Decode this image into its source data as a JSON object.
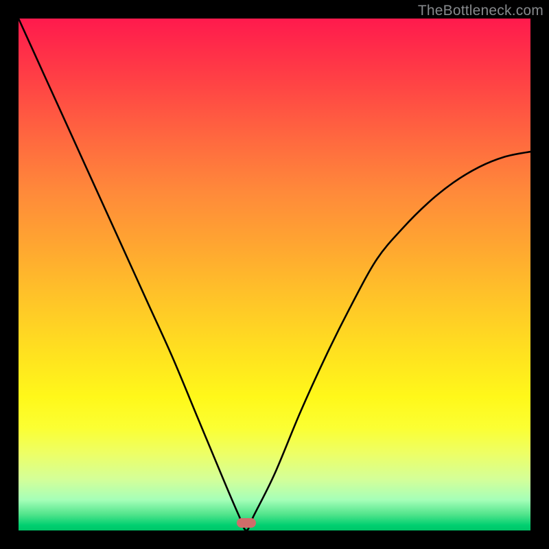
{
  "watermark": "TheBottleneck.com",
  "marker": {
    "x_frac": 0.445,
    "y_frac": 0.985
  },
  "chart_data": {
    "type": "line",
    "title": "",
    "xlabel": "",
    "ylabel": "",
    "xlim": [
      0,
      1
    ],
    "ylim": [
      0,
      1
    ],
    "series": [
      {
        "name": "bottleneck-curve",
        "x": [
          0.0,
          0.05,
          0.1,
          0.15,
          0.2,
          0.25,
          0.3,
          0.35,
          0.4,
          0.43,
          0.445,
          0.46,
          0.5,
          0.55,
          0.6,
          0.65,
          0.7,
          0.75,
          0.8,
          0.85,
          0.9,
          0.95,
          1.0
        ],
        "y": [
          1.0,
          0.89,
          0.78,
          0.67,
          0.56,
          0.45,
          0.34,
          0.22,
          0.1,
          0.03,
          0.0,
          0.03,
          0.11,
          0.23,
          0.34,
          0.44,
          0.53,
          0.59,
          0.64,
          0.68,
          0.71,
          0.73,
          0.74
        ]
      }
    ],
    "marker": {
      "x": 0.445,
      "y": 0.015
    }
  }
}
